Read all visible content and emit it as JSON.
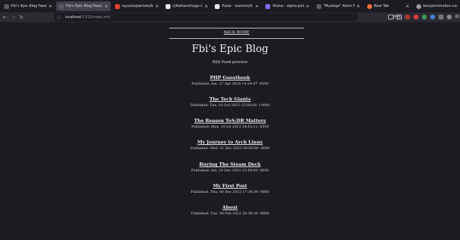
{
  "browser": {
    "tabs": [
      {
        "title": "Fbi's Epic Blog Feed",
        "icon": "page-icon",
        "color": "#5b5b66",
        "active": false
      },
      {
        "title": "Fbi's Epic Blog Feed",
        "icon": "page-icon",
        "color": "#5b5b66",
        "active": true
      },
      {
        "title": "layouts/partials/build",
        "icon": "gitlab-icon",
        "color": "#e24329",
        "active": false
      },
      {
        "title": "cjlheham/hugo-theme",
        "icon": "github-icon",
        "color": "#e6e6e6",
        "active": false
      },
      {
        "title": "Pulse · xianmin/hugo",
        "icon": "github-icon",
        "color": "#e6e6e6",
        "active": false
      },
      {
        "title": "Home - alpha.polymus",
        "icon": "polymus-icon",
        "color": "#7b6cff",
        "active": false
      },
      {
        "title": "\"Musings\" Atom Feed pre",
        "icon": "page-icon",
        "color": "#5b5b66",
        "active": false
      },
      {
        "title": "New Tab",
        "icon": "firefox-icon",
        "color": "#ff7139",
        "active": false
      },
      {
        "title": "benjaminhollon.com",
        "icon": "avatar-icon",
        "color": "#9b9ba3",
        "active": false
      }
    ],
    "url_host": "localhost",
    "url_rest": ":1313/index.xml",
    "zoom": "90%"
  },
  "page": {
    "back_link": "BACK HOME",
    "title": "Fbi's Epic Blog",
    "subtitle": "RSS Feed preview",
    "posts": [
      {
        "title": "PHP Guestbook",
        "date": "Published: Sat, 27 Apr 2024 14:24:47 -0500"
      },
      {
        "title": "The Tech Giants",
        "date": "Published: Tue, 03 Oct 2023 12:00:00 +0000"
      },
      {
        "title": "The Reason ToS;DR Matters",
        "date": "Published: Mon, 10 Jul 2023 14:53:11 -0500"
      },
      {
        "title": "My Journey to Arch Linux",
        "date": "Published: Wed, 21 Dec 2022 09:00:00 -0600"
      },
      {
        "title": "Buying The Steam Deck",
        "date": "Published: Sat, 10 Dec 2022 15:59:09 -0600"
      },
      {
        "title": "My First Post",
        "date": "Published: Thu, 08 Dec 2022 17:38:34 -0600"
      },
      {
        "title": "About",
        "date": "Published: Tue, 08 Feb 2022 20:38:34 -0600"
      }
    ]
  }
}
